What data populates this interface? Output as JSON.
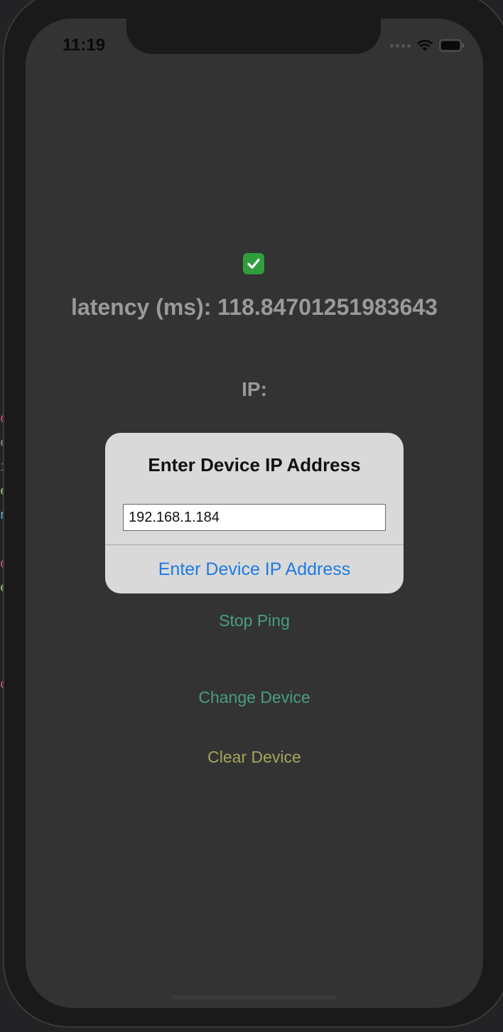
{
  "status_bar": {
    "time": "11:19",
    "wifi_icon": "wifi-icon",
    "battery_icon": "battery-icon"
  },
  "main": {
    "status_icon": "check-mark-icon",
    "status_color": "#2f9e3d",
    "latency_label": "latency (ms):",
    "latency_value": "118.84701251983643",
    "ip_label": "IP:",
    "stop_ping_label": "Stop Ping",
    "change_device_label": "Change Device",
    "clear_device_label": "Clear Device"
  },
  "alert": {
    "title": "Enter Device IP Address",
    "input_value": "192.168.1.184",
    "button_label": "Enter Device IP Address",
    "button_color": "#1f7ae0"
  }
}
